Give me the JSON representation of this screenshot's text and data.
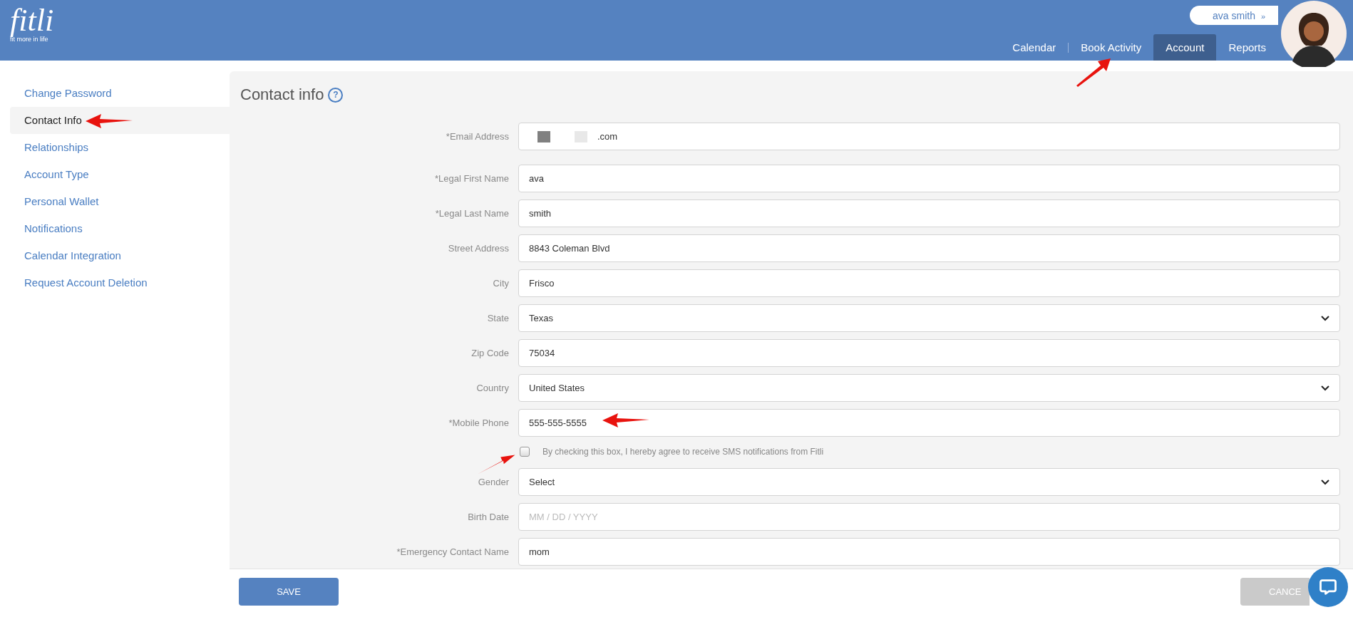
{
  "header": {
    "logo": "fitli",
    "tagline": "fit more in life",
    "user": {
      "name": "ava smith",
      "caret": "»"
    },
    "nav": [
      {
        "label": "Calendar",
        "selected": false
      },
      {
        "label": "Book Activity",
        "selected": false
      },
      {
        "label": "Account",
        "selected": true
      },
      {
        "label": "Reports",
        "selected": false
      }
    ]
  },
  "sidebar": {
    "items": [
      {
        "label": "Change Password",
        "selected": false
      },
      {
        "label": "Contact Info",
        "selected": true
      },
      {
        "label": "Relationships",
        "selected": false
      },
      {
        "label": "Account Type",
        "selected": false
      },
      {
        "label": "Personal Wallet",
        "selected": false
      },
      {
        "label": "Notifications",
        "selected": false
      },
      {
        "label": "Calendar Integration",
        "selected": false
      },
      {
        "label": "Request Account Deletion",
        "selected": false
      }
    ]
  },
  "form": {
    "title": "Contact info",
    "help": "?",
    "fields": [
      {
        "kind": "email",
        "label": "*Email Address",
        "value": ".com"
      },
      {
        "kind": "text",
        "label": "*Legal First Name",
        "value": "ava"
      },
      {
        "kind": "text",
        "label": "*Legal Last Name",
        "value": "smith"
      },
      {
        "kind": "text",
        "label": "Street Address",
        "value": "8843 Coleman Blvd"
      },
      {
        "kind": "text",
        "label": "City",
        "value": "Frisco"
      },
      {
        "kind": "select",
        "label": "State",
        "value": "Texas"
      },
      {
        "kind": "text",
        "label": "Zip Code",
        "value": "75034"
      },
      {
        "kind": "select",
        "label": "Country",
        "value": "United States"
      },
      {
        "kind": "text",
        "label": "*Mobile Phone",
        "value": "555-555-5555"
      },
      {
        "kind": "checkbox",
        "label": "By checking this box, I hereby agree to receive SMS notifications from Fitli",
        "checked": false
      },
      {
        "kind": "select",
        "label": "Gender",
        "value": "Select"
      },
      {
        "kind": "text",
        "label": "Birth Date",
        "placeholder": "MM / DD / YYYY"
      },
      {
        "kind": "text",
        "label": "*Emergency Contact Name",
        "value": "mom"
      }
    ],
    "buttons": [
      {
        "kind": "primary",
        "label": "SAVE"
      },
      {
        "kind": "secondary",
        "label": "CANCE"
      }
    ]
  }
}
